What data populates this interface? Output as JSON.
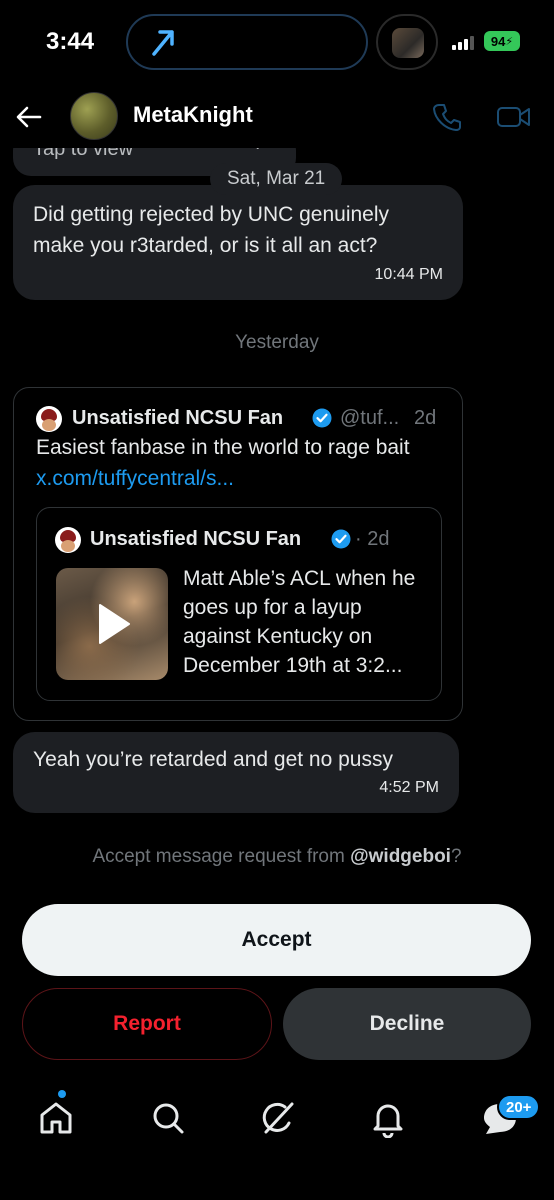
{
  "status_bar": {
    "time": "3:44",
    "battery": "94"
  },
  "header": {
    "contact_name": "MetaKnight"
  },
  "conversation": {
    "partial_message": {
      "text": "Tap to view"
    },
    "date_divider": "Sat, Mar 21",
    "message_1": {
      "text": "Did getting rejected by UNC genuinely make you r3tarded, or is it all an act?",
      "timestamp": "10:44 PM"
    },
    "day_divider": "Yesterday",
    "shared_post": {
      "author": "Unsatisfied NCSU Fan",
      "handle": "@tuf...",
      "age": "2d",
      "text": "Easiest fanbase in the world to rage bait",
      "link": "x.com/tuffycentral/s...",
      "quoted": {
        "author": "Unsatisfied NCSU Fan",
        "age": "· 2d",
        "text": "Matt Able’s ACL when he goes up for a layup against Kentucky on December 19th at 3:2..."
      }
    },
    "message_2": {
      "text": "Yeah you’re retarded and get no pussy",
      "timestamp": "4:52 PM"
    }
  },
  "request": {
    "prompt": "Accept message request from ",
    "username": "@widgeboi",
    "suffix": "?",
    "accept_label": "Accept",
    "report_label": "Report",
    "decline_label": "Decline"
  },
  "nav": {
    "items": [
      "home-icon",
      "search-icon",
      "grok-icon",
      "notifications-icon",
      "messages-icon"
    ],
    "messages_badge": "20+"
  },
  "colors": {
    "accent": "#1d9bf0",
    "danger": "#f4212e",
    "bubble": "#1d1f23",
    "muted": "#71767b"
  }
}
